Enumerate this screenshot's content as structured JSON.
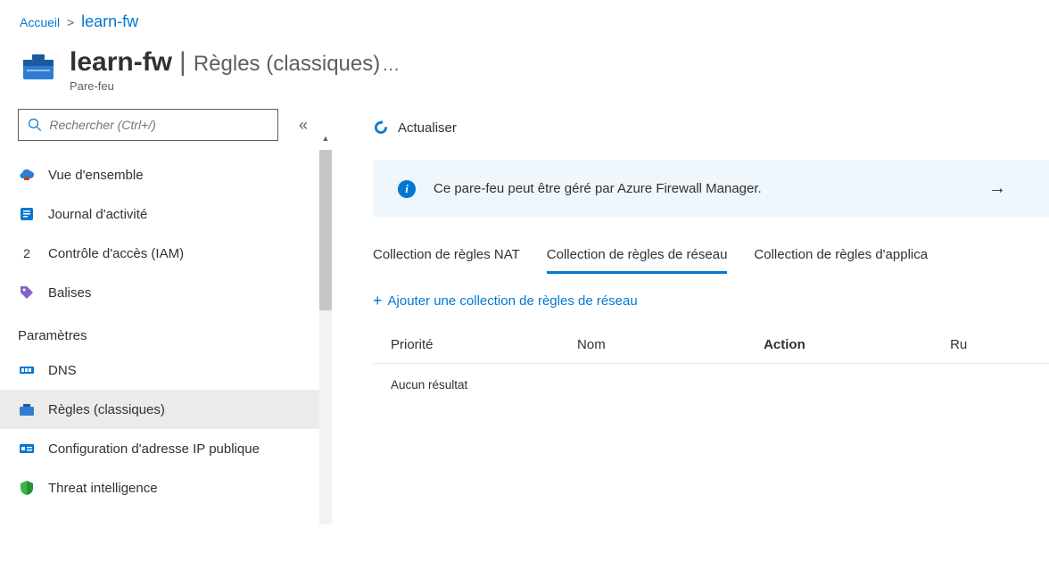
{
  "breadcrumb": {
    "home": "Accueil",
    "current": "learn-fw"
  },
  "header": {
    "title": "learn-fw",
    "subtitle": "Règles (classiques)",
    "resource_type": "Pare-feu"
  },
  "search": {
    "placeholder": "Rechercher (Ctrl+/)"
  },
  "sidebar": {
    "items": [
      {
        "label": "Vue d'ensemble",
        "icon": "overview"
      },
      {
        "label": "Journal d'activité",
        "icon": "activity-log"
      },
      {
        "label": "Contrôle d'accès (IAM)",
        "icon": "iam",
        "text_icon": "2"
      },
      {
        "label": "Balises",
        "icon": "tag"
      }
    ],
    "section_label": "Paramètres",
    "settings": [
      {
        "label": "DNS",
        "icon": "dns"
      },
      {
        "label": "Règles (classiques)",
        "icon": "rules",
        "selected": true
      },
      {
        "label": "Configuration d'adresse IP publique",
        "icon": "ip"
      },
      {
        "label": "Threat intelligence",
        "icon": "shield"
      }
    ]
  },
  "toolbar": {
    "refresh": "Actualiser"
  },
  "banner": {
    "message": "Ce pare-feu peut être géré par Azure Firewall Manager."
  },
  "tabs": {
    "nat": "Collection de règles NAT",
    "network": "Collection de règles de réseau",
    "application": "Collection de règles d'applica"
  },
  "add_link": "Ajouter une collection de règles de réseau",
  "table": {
    "headers": {
      "priority": "Priorité",
      "name": "Nom",
      "action": "Action",
      "rules": "Ru"
    },
    "empty": "Aucun résultat"
  }
}
